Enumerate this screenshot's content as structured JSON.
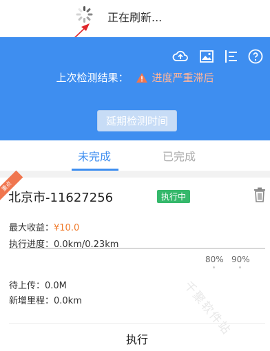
{
  "refresh": {
    "text": "正在刷新..."
  },
  "header": {
    "icons": [
      "cloud-upload-icon",
      "image-icon",
      "align-list-icon",
      "help-circle-icon"
    ],
    "last_result_label": "上次检测结果：",
    "last_result_value": "进度严重滞后",
    "delay_button": "延期检测时间"
  },
  "tabs": {
    "active": "未完成",
    "inactive": "已完成"
  },
  "task": {
    "ribbon": "重点",
    "plate": "北京市-11627256",
    "status": "执行中",
    "max_income_label": "最大收益：",
    "max_income_value": "¥10.0",
    "progress_label": "执行进度：0.0km/0.23km",
    "marker_80": "80%",
    "marker_90": "90%",
    "pending_upload": "待上传：0.0M",
    "added_mileage": "新增里程：0.0km",
    "execute_button": "执行"
  },
  "watermark": "千聚软件站",
  "colors": {
    "primary": "#3e8ef0",
    "warning": "#f0764f",
    "status_green": "#35b86b",
    "income_orange": "#f07a2a"
  }
}
